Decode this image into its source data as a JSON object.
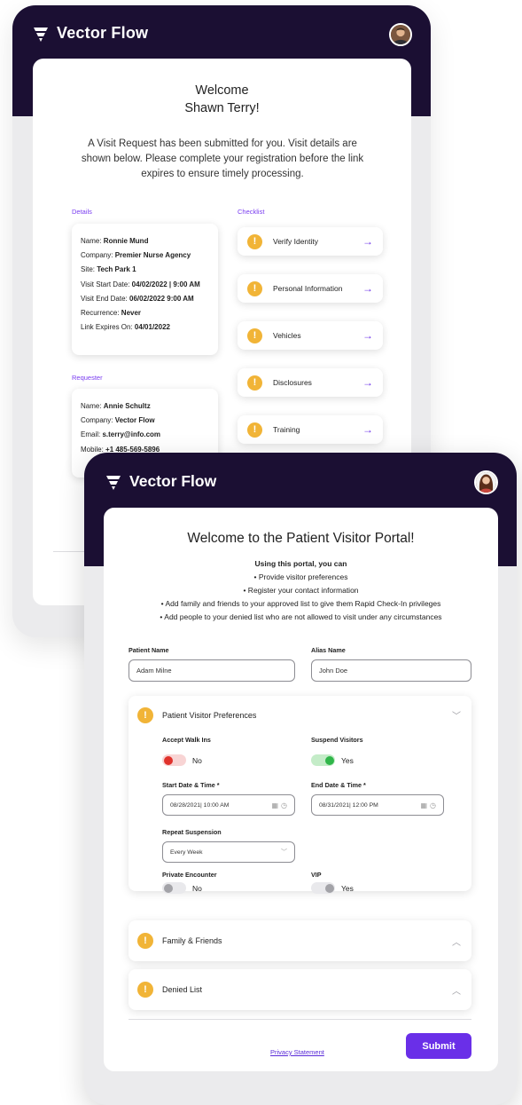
{
  "back": {
    "brand": "Vector Flow",
    "welcome_line1": "Welcome",
    "welcome_line2": "Shawn Terry!",
    "intro": "A Visit Request has been submitted for you. Visit details are shown below. Please complete your registration before the link expires to ensure timely processing.",
    "details_label": "Details",
    "checklist_label": "Checklist",
    "requester_label": "Requester",
    "details": [
      {
        "label": "Name: ",
        "value": "Ronnie Mund"
      },
      {
        "label": "Company: ",
        "value": "Premier Nurse Agency"
      },
      {
        "label": "Site: ",
        "value": "Tech Park 1"
      },
      {
        "label": "Visit Start Date: ",
        "value": "04/02/2022 | 9:00 AM"
      },
      {
        "label": "Visit End Date: ",
        "value": "06/02/2022 9:00 AM"
      },
      {
        "label": "Recurrence: ",
        "value": "Never"
      },
      {
        "label": "Link Expires On: ",
        "value": "04/01/2022"
      }
    ],
    "requester": [
      {
        "label": "Name: ",
        "value": "Annie Schultz"
      },
      {
        "label": "Company: ",
        "value": "Vector Flow"
      },
      {
        "label": "Email: ",
        "value": "s.terry@info.com"
      },
      {
        "label": "Mobile: ",
        "value": "+1 485-569-5896"
      }
    ],
    "checklist": [
      {
        "label": "Verify Identity"
      },
      {
        "label": "Personal Information"
      },
      {
        "label": "Vehicles"
      },
      {
        "label": "Disclosures"
      },
      {
        "label": "Training"
      }
    ]
  },
  "front": {
    "brand": "Vector Flow",
    "title": "Welcome to the Patient Visitor Portal!",
    "subtitle": "Using this portal, you can",
    "bullets": [
      "• Provide visitor preferences",
      "• Register your contact information",
      "• Add family and friends to your approved list to give them Rapid Check-In privileges",
      "• Add people to your denied list who are not allowed to visit under any circumstances"
    ],
    "patient_name_label": "Patient Name",
    "patient_name_value": "Adam Milne",
    "alias_name_label": "Alias Name",
    "alias_name_value": "John Doe",
    "preferences": {
      "title": "Patient Visitor Preferences",
      "accept_walk_ins_label": "Accept Walk Ins",
      "accept_walk_ins_value": "No",
      "suspend_visitors_label": "Suspend Visitors",
      "suspend_visitors_value": "Yes",
      "start_label": "Start Date & Time *",
      "start_value": "08/28/2021| 10:00 AM",
      "end_label": "End Date & Time *",
      "end_value": "08/31/2021| 12:00 PM",
      "repeat_label": "Repeat Suspension",
      "repeat_value": "Every Week",
      "private_label": "Private Encounter",
      "private_value": "No",
      "vip_label": "VIP",
      "vip_value": "Yes"
    },
    "family_title": "Family & Friends",
    "denied_title": "Denied List",
    "privacy": "Privacy Statement",
    "submit": "Submit"
  },
  "colors": {
    "header": "#1b0f33",
    "accent": "#6a2fe8",
    "warning": "#f1b437",
    "toggle_red": "#e0322c",
    "toggle_green": "#30b64a"
  },
  "icons": [
    "vector-flow-logo-icon",
    "warning-icon",
    "arrow-right-icon",
    "chevron-down-icon",
    "chevron-up-icon",
    "calendar-icon",
    "clock-icon"
  ]
}
